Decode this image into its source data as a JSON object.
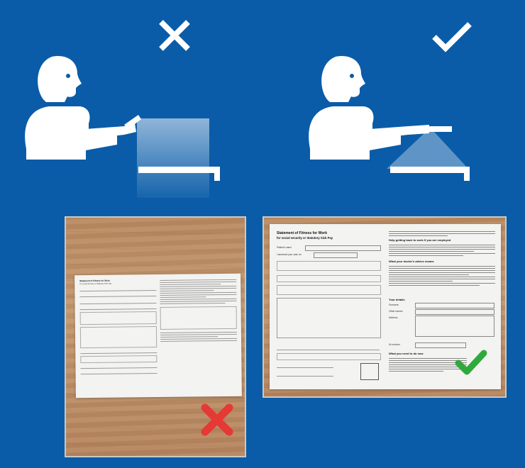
{
  "colors": {
    "background": "#0a5ca8",
    "figure": "#ffffff",
    "wrong_mark": "#e53935",
    "right_mark": "#2eaa3c"
  },
  "icons": {
    "top_left": "cross-icon",
    "top_right": "check-icon",
    "photo_left_mark": "red-cross-icon",
    "photo_right_mark": "green-check-icon"
  },
  "document": {
    "title_line1": "Statement of Fitness for Work",
    "title_line2": "for social security or Statutory Sick Pay",
    "patient_name_label": "Patient's name",
    "assessed_case_label": "I assessed your case on:",
    "right_heading_1": "Help getting back to work if you are employed",
    "right_heading_2": "What your doctor's advice means",
    "your_details_label": "Your details",
    "surname_label": "Surname",
    "other_names_label": "Other names",
    "address_label": "Address",
    "ni_number_label": "NI number",
    "what_next_label": "What you need to do now"
  }
}
